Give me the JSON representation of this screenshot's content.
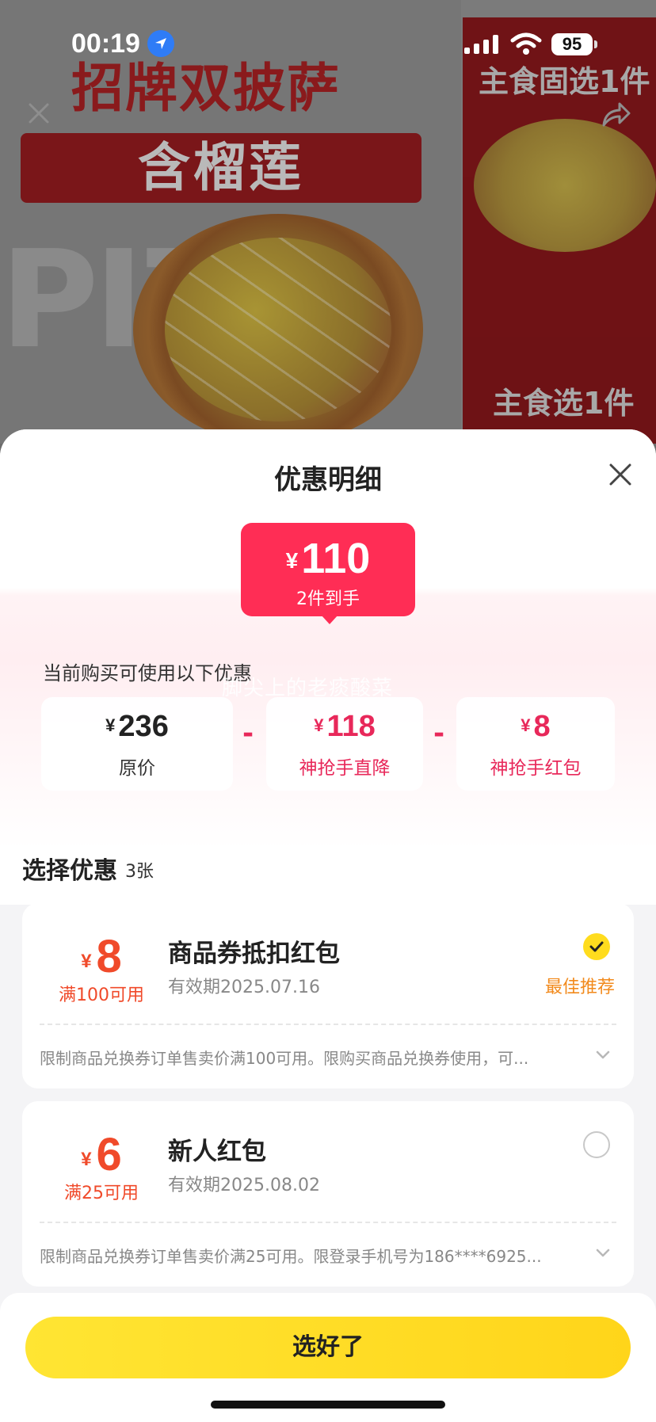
{
  "status_bar": {
    "time": "00:19",
    "battery": "95"
  },
  "background": {
    "headline": "招牌双披萨",
    "banner_text": "含榴莲",
    "pizza_letters": "PIZZ",
    "right_text_top": "主食固选1件",
    "right_text_bottom": "主食选1件"
  },
  "sheet": {
    "title": "优惠明细",
    "price_badge": {
      "currency": "¥",
      "amount": "110",
      "subtitle": "2件到手"
    },
    "available_text": "当前购买可使用以下优惠",
    "watermark": "脚尖上的老痰酸菜",
    "calculation": [
      {
        "currency": "¥",
        "amount": "236",
        "label": "原价"
      },
      {
        "currency": "¥",
        "amount": "118",
        "label": "神抢手直降"
      },
      {
        "currency": "¥",
        "amount": "8",
        "label": "神抢手红包"
      }
    ],
    "operator": "-",
    "section": {
      "title": "选择优惠",
      "count": "3张"
    },
    "coupons": [
      {
        "currency": "¥",
        "amount": "8",
        "condition": "满100可用",
        "title": "商品券抵扣红包",
        "expire": "有效期2025.07.16",
        "tag": "最佳推荐",
        "selected": true,
        "description": "限制商品兑换券订单售卖价满100可用。限购买商品兑换券使用，可..."
      },
      {
        "currency": "¥",
        "amount": "6",
        "condition": "满25可用",
        "title": "新人红包",
        "expire": "有效期2025.08.02",
        "tag": "",
        "selected": false,
        "description": "限制商品兑换券订单售卖价满25可用。限登录手机号为186****6925..."
      }
    ],
    "confirm_button": "选好了"
  },
  "colors": {
    "accent_pink": "#ff2d55",
    "coupon_red": "#f04a2a",
    "tag_orange": "#f28a1c",
    "button_yellow": "#ffdc1e"
  },
  "icons": [
    "location-arrow-icon",
    "signal-icon",
    "wifi-icon",
    "close-icon",
    "share-icon",
    "checkmark-icon",
    "chevron-down-icon"
  ]
}
